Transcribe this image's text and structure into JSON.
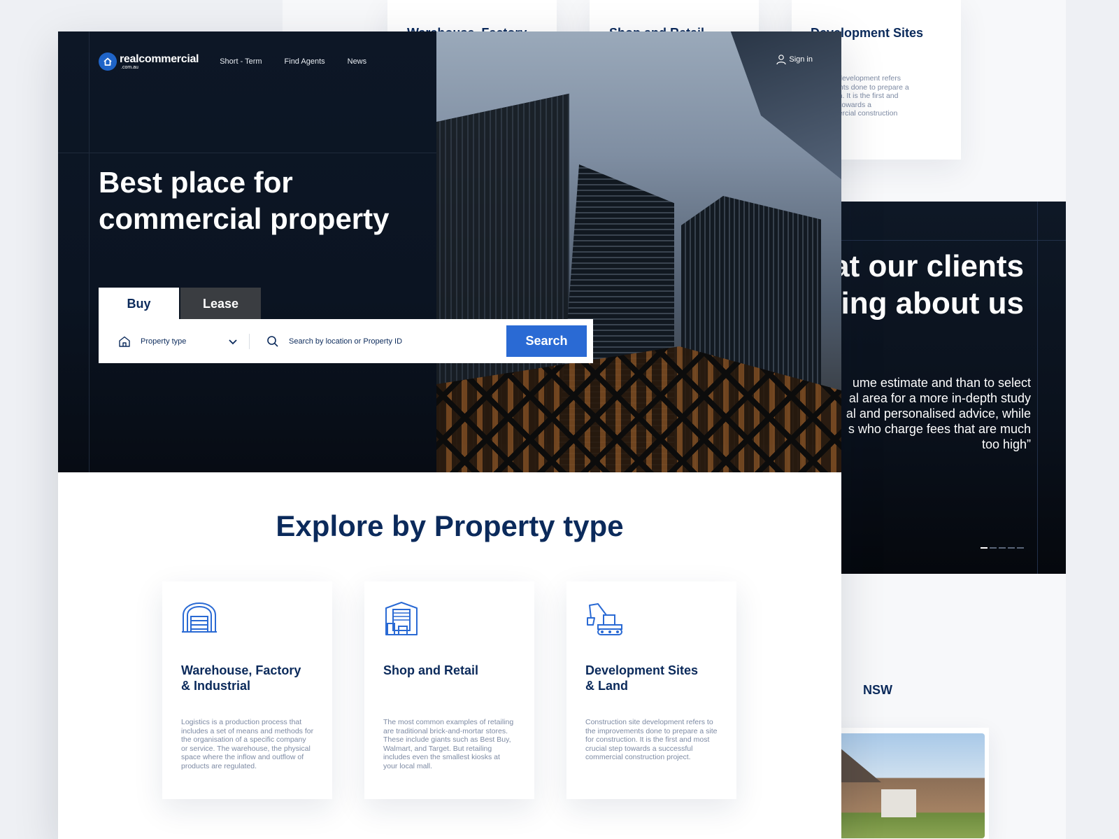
{
  "colors": {
    "brand_blue": "#2a6ad4",
    "navy": "#0b2a5b",
    "hero_dark": "#0b1420",
    "muted_text": "#7d8aa3"
  },
  "background_page": {
    "cards": [
      {
        "title": "Warehouse, Factory",
        "description": ""
      },
      {
        "title": "Shop and Retail",
        "description": ""
      },
      {
        "title": "Development Sites\nLand",
        "description": "tion site development refers\nprovements done to prepare a\nnstruction. It is the first and\ncial step towards a\nul commercial construction"
      }
    ],
    "testimonial": {
      "heading": "at our clients\nying about us",
      "quote": "ume estimate and than to select\nal area for a more in-depth study\nal and personalised advice, while\ns who charge fees that are much\ntoo high”",
      "slider_dots": 5,
      "active_dot": 0
    },
    "region_label": "NSW"
  },
  "header": {
    "logo_name": "realcommercial",
    "logo_suffix": ".com.au",
    "logo_icon": "house-icon",
    "nav": [
      "Short - Term",
      "Find Agents",
      "News"
    ],
    "signin_label": "Sign in",
    "signin_icon": "user-icon"
  },
  "hero": {
    "title": "Best place for\ncommercial property",
    "tabs": [
      {
        "label": "Buy",
        "active": true
      },
      {
        "label": "Lease",
        "active": false
      }
    ],
    "property_type_label": "Property type",
    "property_type_icon": "home-icon",
    "search_icon": "search-icon",
    "search_placeholder": "Search by location or Property ID",
    "search_button": "Search"
  },
  "explore": {
    "title": "Explore by Property type",
    "cards": [
      {
        "icon": "warehouse-icon",
        "title": "Warehouse, Factory\n& Industrial",
        "description": "Logistics is a production process that includes a set of means and methods for the organisation of a specific company or service. The warehouse, the physical space where the inflow and outflow of products are regulated."
      },
      {
        "icon": "storefront-icon",
        "title": "Shop and Retail",
        "description": "The most common examples of retailing are traditional brick-and-mortar stores. These include giants such as Best Buy, Walmart, and Target. But retailing includes even the smallest kiosks at your local mall."
      },
      {
        "icon": "excavator-icon",
        "title": "Development Sites\n& Land",
        "description": "Construction site development refers to the improvements done to prepare a site for construction. It is the first and most crucial step towards a successful commercial construction project."
      }
    ]
  }
}
